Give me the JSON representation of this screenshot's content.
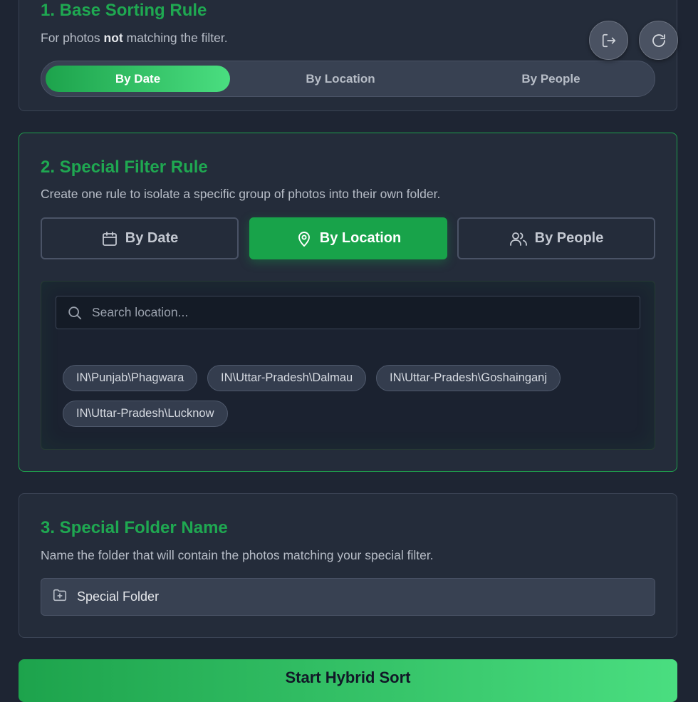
{
  "base_rule": {
    "title": "1. Base Sorting Rule",
    "desc_pre": "For photos ",
    "desc_bold": "not",
    "desc_post": " matching the filter.",
    "options": [
      "By Date",
      "By Location",
      "By People"
    ],
    "selected": "By Date"
  },
  "special_filter": {
    "title": "2. Special Filter Rule",
    "desc": "Create one rule to isolate a specific group of photos into their own folder.",
    "tabs": [
      {
        "label": "By Date",
        "icon": "calendar-icon"
      },
      {
        "label": "By Location",
        "icon": "map-pin-icon"
      },
      {
        "label": "By People",
        "icon": "users-icon"
      }
    ],
    "selected": "By Location",
    "search_placeholder": "Search location...",
    "locations": [
      "IN\\Punjab\\Phagwara",
      "IN\\Uttar-Pradesh\\Dalmau",
      "IN\\Uttar-Pradesh\\Goshainganj",
      "IN\\Uttar-Pradesh\\Lucknow"
    ]
  },
  "folder_name": {
    "title": "3. Special Folder Name",
    "desc": "Name the folder that will contain the photos matching your special filter.",
    "value": "Special Folder",
    "icon": "folder-plus-icon"
  },
  "actions": {
    "logout_icon": "logout-icon",
    "refresh_icon": "refresh-icon",
    "start_label": "Start Hybrid Sort"
  },
  "colors": {
    "accent": "#18a34a",
    "accent_light": "#4ade80",
    "background": "#1e2533",
    "card": "#242c3a"
  }
}
